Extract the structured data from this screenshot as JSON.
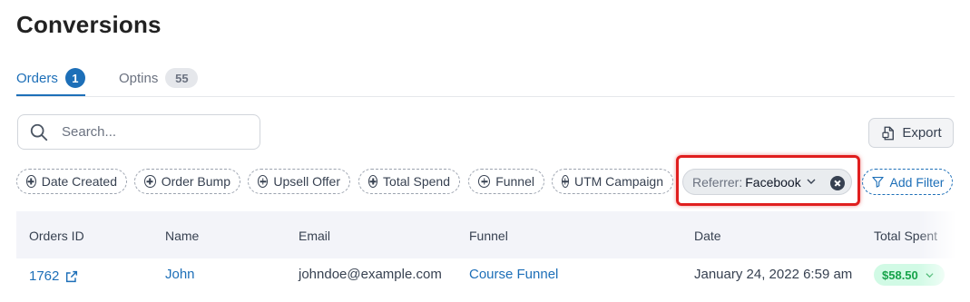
{
  "page": {
    "title": "Conversions"
  },
  "tabs": [
    {
      "label": "Orders",
      "count": "1",
      "active": true
    },
    {
      "label": "Optins",
      "count": "55",
      "active": false
    }
  ],
  "search": {
    "placeholder": "Search...",
    "value": "",
    "icon": "search-icon"
  },
  "toolbar": {
    "export_label": "Export",
    "export_icon": "export-icon"
  },
  "filters": [
    {
      "label": "Date Created"
    },
    {
      "label": "Order Bump"
    },
    {
      "label": "Upsell Offer"
    },
    {
      "label": "Total Spend"
    },
    {
      "label": "Funnel"
    },
    {
      "label": "UTM Campaign"
    }
  ],
  "active_filter": {
    "key": "Referrer:",
    "value": "Facebook"
  },
  "add_filter": {
    "label": "Add Filter",
    "icon": "filter-icon"
  },
  "table": {
    "columns": [
      "Orders ID",
      "Name",
      "Email",
      "Funnel",
      "Date",
      "Total Spent"
    ],
    "rows": [
      {
        "id": "1762",
        "name": "John",
        "email": "johndoe@example.com",
        "funnel": "Course Funnel",
        "date": "January 24, 2022 6:59 am",
        "total": "$58.50"
      }
    ]
  },
  "colors": {
    "accent": "#1d6fb8",
    "highlight": "#e01e1e",
    "success": "#16a34a"
  }
}
